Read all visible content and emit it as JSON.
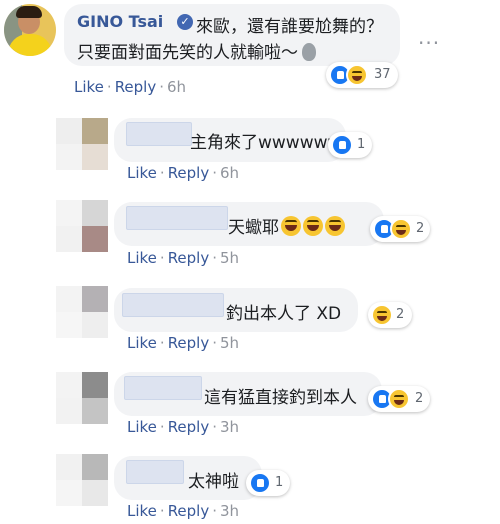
{
  "main_comment": {
    "author": "GINO Tsai",
    "line1": "來歐，還有誰要尬舞的？",
    "line2": "只要面對面先笑的人就輸啦～",
    "reactions_count": "37",
    "like_label": "Like",
    "reply_label": "Reply",
    "time": "6h"
  },
  "replies": [
    {
      "text": "主角來了wwwwww",
      "reactions_count": "1",
      "like_label": "Like",
      "reply_label": "Reply",
      "time": "6h"
    },
    {
      "text": "天蠍耶",
      "reactions_count": "2",
      "like_label": "Like",
      "reply_label": "Reply",
      "time": "5h"
    },
    {
      "text": "釣出本人了 XD",
      "reactions_count": "2",
      "like_label": "Like",
      "reply_label": "Reply",
      "time": "5h"
    },
    {
      "text": "這有猛直接釣到本人",
      "reactions_count": "2",
      "like_label": "Like",
      "reply_label": "Reply",
      "time": "3h"
    },
    {
      "text": "太神啦",
      "reactions_count": "1",
      "like_label": "Like",
      "reply_label": "Reply",
      "time": "3h"
    }
  ],
  "colors": {
    "link": "#385898",
    "bubble": "#f2f3f5",
    "like": "#1877f2",
    "haha": "#f7c531"
  },
  "icons": [
    "verified-icon",
    "alien-icon",
    "more-options-icon",
    "like-reaction-icon",
    "haha-reaction-icon",
    "laughing-emoji-icon"
  ]
}
